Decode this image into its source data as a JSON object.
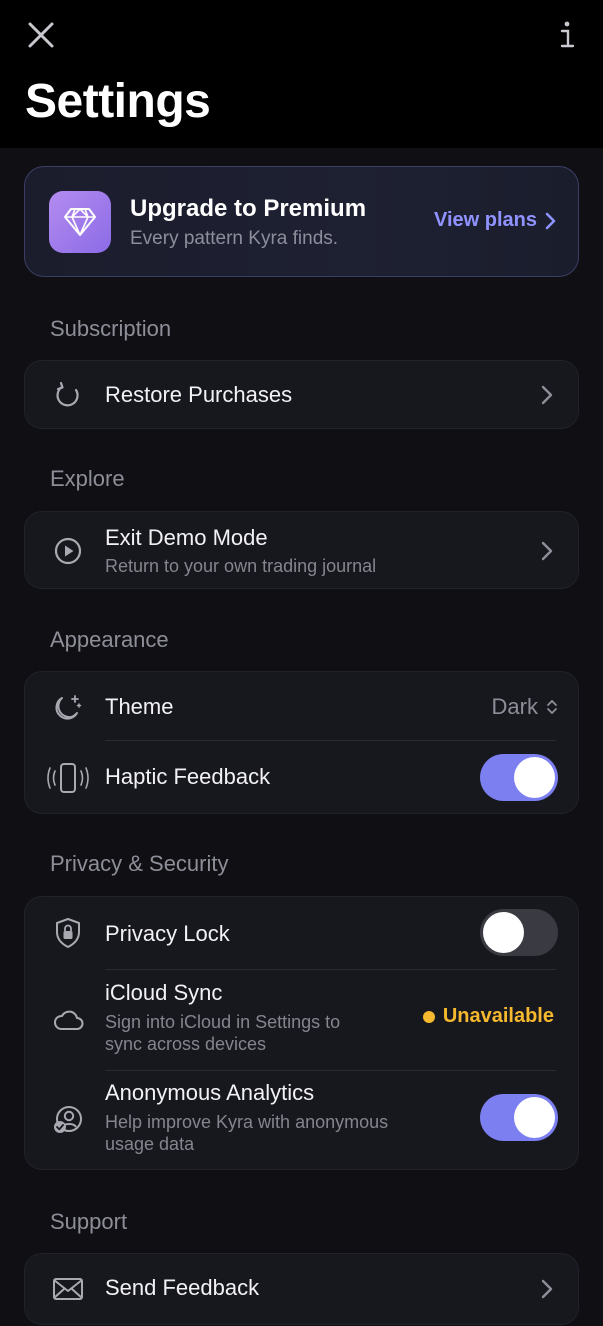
{
  "header": {
    "title": "Settings",
    "close_icon": "close-icon",
    "info_icon": "info-icon"
  },
  "premium": {
    "title": "Upgrade to Premium",
    "subtitle": "Every pattern Kyra finds.",
    "action": "View plans",
    "icon": "diamond-icon",
    "accent": "#8f92ff"
  },
  "sections": {
    "subscription": {
      "label": "Subscription",
      "restore": {
        "title": "Restore Purchases",
        "icon": "refresh-icon"
      }
    },
    "explore": {
      "label": "Explore",
      "demo": {
        "title": "Exit Demo Mode",
        "subtitle": "Return to your own trading journal",
        "icon": "play-circle-icon"
      }
    },
    "appearance": {
      "label": "Appearance",
      "theme": {
        "title": "Theme",
        "value": "Dark",
        "icon": "moon-stars-icon"
      },
      "haptic": {
        "title": "Haptic Feedback",
        "enabled": true,
        "icon": "phone-vibrate-icon"
      }
    },
    "privacy": {
      "label": "Privacy & Security",
      "lock": {
        "title": "Privacy Lock",
        "enabled": false,
        "icon": "shield-lock-icon"
      },
      "icloud": {
        "title": "iCloud Sync",
        "subtitle_line1": "Sign into iCloud in Settings to",
        "subtitle_line2": "sync across devices",
        "status": "Unavailable",
        "status_color": "#f5b82e",
        "icon": "cloud-icon"
      },
      "analytics": {
        "title": "Anonymous Analytics",
        "subtitle_line1": "Help improve Kyra with anonymous",
        "subtitle_line2": "usage data",
        "enabled": true,
        "icon": "person-check-icon"
      }
    },
    "support": {
      "label": "Support",
      "feedback": {
        "title": "Send Feedback",
        "icon": "envelope-icon"
      }
    }
  },
  "colors": {
    "toggle_on": "#7c7ff0",
    "toggle_off": "#3a3a42",
    "background": "#0f0f14"
  }
}
